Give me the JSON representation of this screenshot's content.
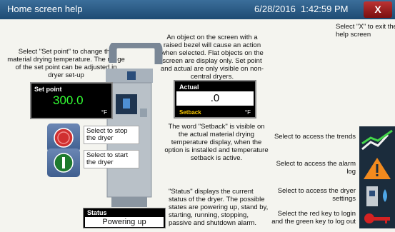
{
  "window": {
    "title": "Home screen help",
    "date": "6/28/2016",
    "time": "1:42:59 PM",
    "close_label": "X"
  },
  "help": {
    "exit": "Select \"X\" to exit the help screen",
    "setpoint": "Select \"Set point\" to change the material drying temperature. The range of the set point can be adjusted in dryer set-up",
    "bezel": "An object on the screen with a raised bezel will cause an action when selected. Flat objects on the screen are display only. Set point and actual are only visible on non-central dryers.",
    "setback": "The word \"Setback\" is visible on the actual material drying temperature display, when the option is installed and temperature setback is active.",
    "status": "\"Status\" displays the current status of the dryer. The possible states are powering up, stand by, starting, running, stopping, passive and shutdown alarm."
  },
  "setpoint": {
    "label": "Set point",
    "value": "300.0",
    "unit": "°F"
  },
  "actual": {
    "label": "Actual",
    "value": ".0",
    "setback": "Setback",
    "unit": "°F"
  },
  "controls": {
    "stop_label": "Select to stop the dryer",
    "start_label": "Select to start the dryer"
  },
  "status": {
    "label": "Status",
    "value": "Powering up"
  },
  "nav": {
    "trends": "Select to access the trends",
    "alarm": "Select to access the alarm log",
    "settings": "Select to access the dryer settings",
    "login": "Select the red key to login and the green key to log out"
  },
  "colors": {
    "titlebar": "#1e4b73",
    "setpoint_value": "#33ff33",
    "setback": "#ffcc00",
    "stop": "#d03030",
    "start": "#1e7a2e"
  }
}
